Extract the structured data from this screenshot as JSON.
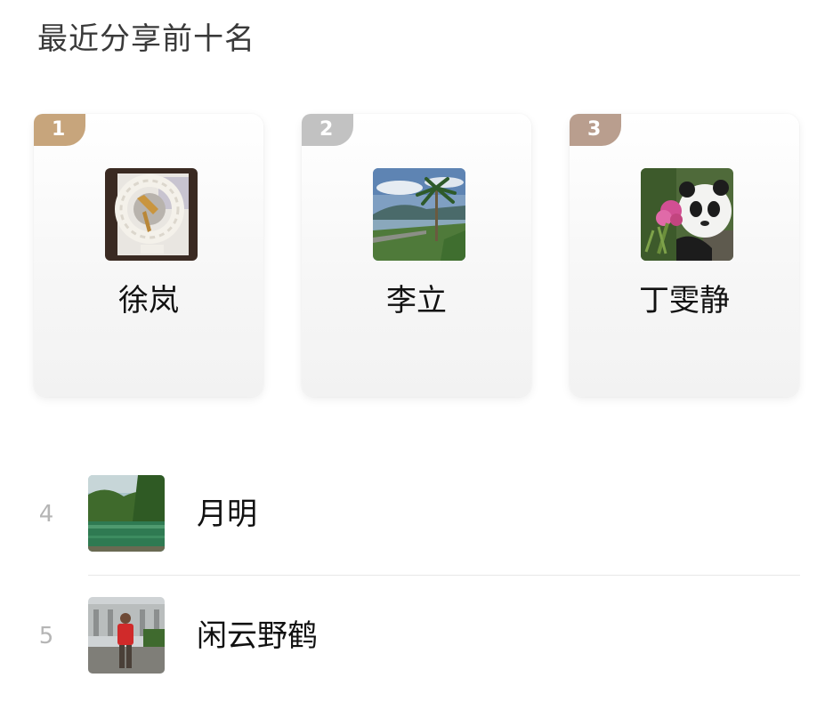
{
  "section": {
    "title": "最近分享前十名"
  },
  "podium": [
    {
      "rank": "1",
      "name": "徐岚",
      "avatar": "photo-avatar-wreath",
      "badge_color": "#c7a57c"
    },
    {
      "rank": "2",
      "name": "李立",
      "avatar": "photo-avatar-palm-coast",
      "badge_color": "#c2c2c2"
    },
    {
      "rank": "3",
      "name": "丁雯静",
      "avatar": "photo-avatar-panda",
      "badge_color": "#b99e8e"
    }
  ],
  "list": [
    {
      "rank": "4",
      "name": "月明",
      "avatar": "photo-avatar-lake"
    },
    {
      "rank": "5",
      "name": "闲云野鹤",
      "avatar": "photo-avatar-person-red-jacket"
    }
  ],
  "colors": {
    "gold": "#c7a57c",
    "silver": "#c2c2c2",
    "bronze": "#b99e8e",
    "rank_text": "#b5b5b5"
  }
}
